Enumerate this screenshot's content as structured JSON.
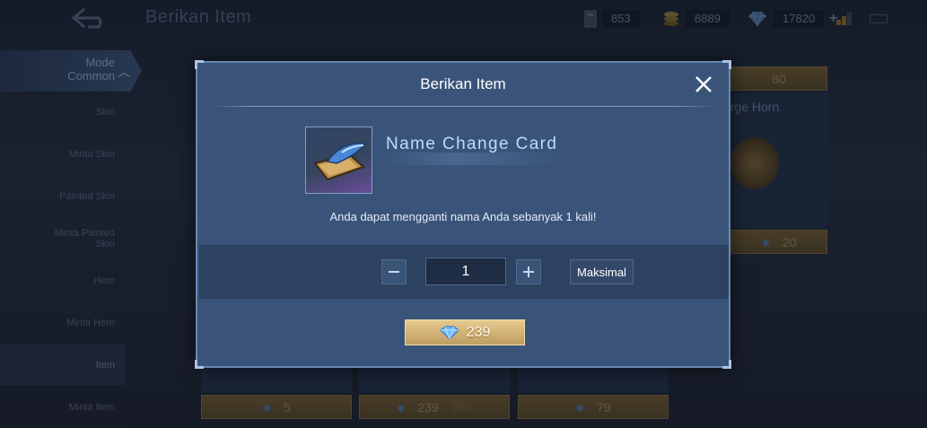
{
  "header": {
    "title": "Berikan Item",
    "currencies": [
      {
        "icon": "ticket-icon",
        "value": "853"
      },
      {
        "icon": "coin-icon",
        "value": "8889"
      },
      {
        "icon": "diamond-icon",
        "value": "17820"
      }
    ]
  },
  "sidebar": {
    "mode_label_line1": "Mode",
    "mode_label_line2": "Common",
    "items": [
      {
        "label": "Skin"
      },
      {
        "label": "Minta Skin"
      },
      {
        "label": "Painted Skin"
      },
      {
        "label_line1": "Minta Painted",
        "label_line2": "Skin"
      },
      {
        "label": "Hero"
      },
      {
        "label": "Minta Hero"
      },
      {
        "label": "Item"
      },
      {
        "label": "Minta Item"
      }
    ]
  },
  "background": {
    "horn_label": "arge Horn",
    "top_price": "80",
    "horn_price": "20",
    "bottom_prices": [
      "5",
      "239",
      "79"
    ],
    "faded_price": "289"
  },
  "modal": {
    "title": "Berikan Item",
    "item_name": "Name Change Card",
    "description": "Anda dapat mengganti nama Anda sebanyak 1 kali!",
    "quantity": "1",
    "max_label": "Maksimal",
    "price": "239"
  },
  "colors": {
    "modal_bg": "#3a5479",
    "price_gold": "#d0b073",
    "diamond": "#6fb8ff"
  }
}
